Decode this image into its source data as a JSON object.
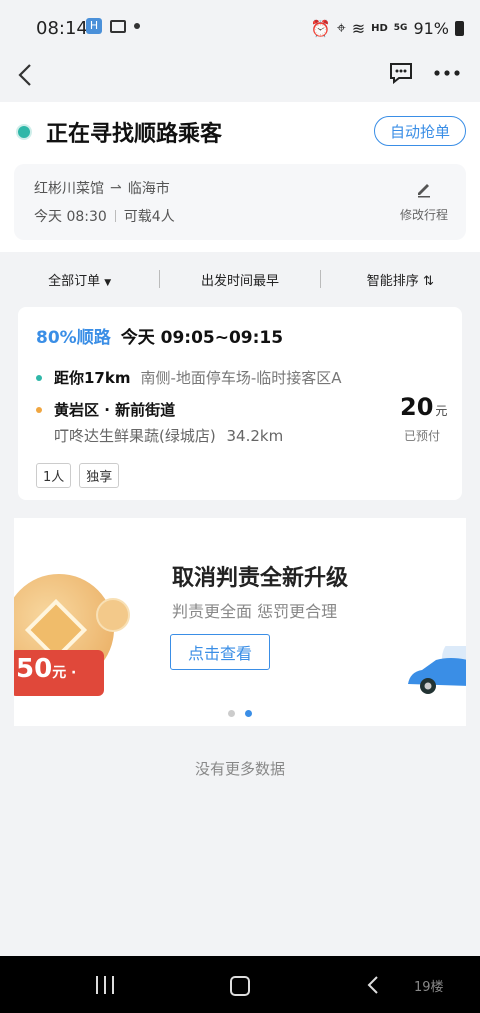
{
  "status_bar": {
    "time": "08:14",
    "battery": "91%",
    "net": "HD",
    "signal": "5G"
  },
  "header": {
    "title": "正在寻找顺路乘客",
    "auto_button": "自动抢单"
  },
  "trip": {
    "from": "红彬川菜馆",
    "arrow": "⇀",
    "to": "临海市",
    "time": "今天 08:30",
    "seats": "可载4人",
    "edit_label": "修改行程"
  },
  "filters": {
    "all": "全部订单",
    "earliest": "出发时间最早",
    "smart": "智能排序"
  },
  "order": {
    "match": "80%顺路",
    "window": "今天 09:05~09:15",
    "pickup_distance": "距你17km",
    "pickup_place": "南侧-地面停车场-临时接客区A",
    "dest_area": "黄岩区 · 新前街道",
    "dest_place": "叮咚达生鲜果蔬(绿城店)",
    "dest_distance": "34.2km",
    "price": "20",
    "price_unit": "元",
    "paid": "已预付",
    "tags": [
      "1人",
      "独享"
    ]
  },
  "banner": {
    "title": "取消判责全新升级",
    "subtitle": "判责更全面 惩罚更合理",
    "button": "点击查看",
    "coupon_amount": "50",
    "coupon_unit": "元 ·",
    "active_slide": 2,
    "slide_count": 2
  },
  "footer": {
    "no_more": "没有更多数据",
    "watermark": "19楼"
  },
  "colors": {
    "accent": "#3a8ee6",
    "teal": "#2fb7a8",
    "orange": "#f0a640",
    "coupon_red": "#e0483a"
  }
}
